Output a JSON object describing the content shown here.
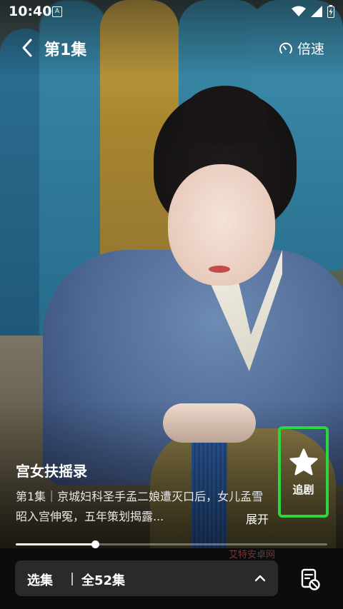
{
  "status_bar": {
    "time": "10:40",
    "notification_badge": "A"
  },
  "header": {
    "episode_title": "第1集",
    "speed_label": "倍速"
  },
  "info": {
    "show_title": "宫女扶摇录",
    "description": "第1集｜京城妇科圣手孟二娘遭灭口后，女儿孟雪昭入宫伸冤，五年策划揭露...",
    "expand_label": "展开"
  },
  "follow": {
    "label": "追剧"
  },
  "progress": {
    "fraction": 0.255
  },
  "episode_picker": {
    "label": "选集",
    "count": "全52集"
  },
  "watermark": {
    "text": "艾特安卓网"
  },
  "colors": {
    "highlight_border": "#2bd63e",
    "bottom_bar": "#0c0c0c",
    "picker_bg": "#2a2a2a"
  }
}
